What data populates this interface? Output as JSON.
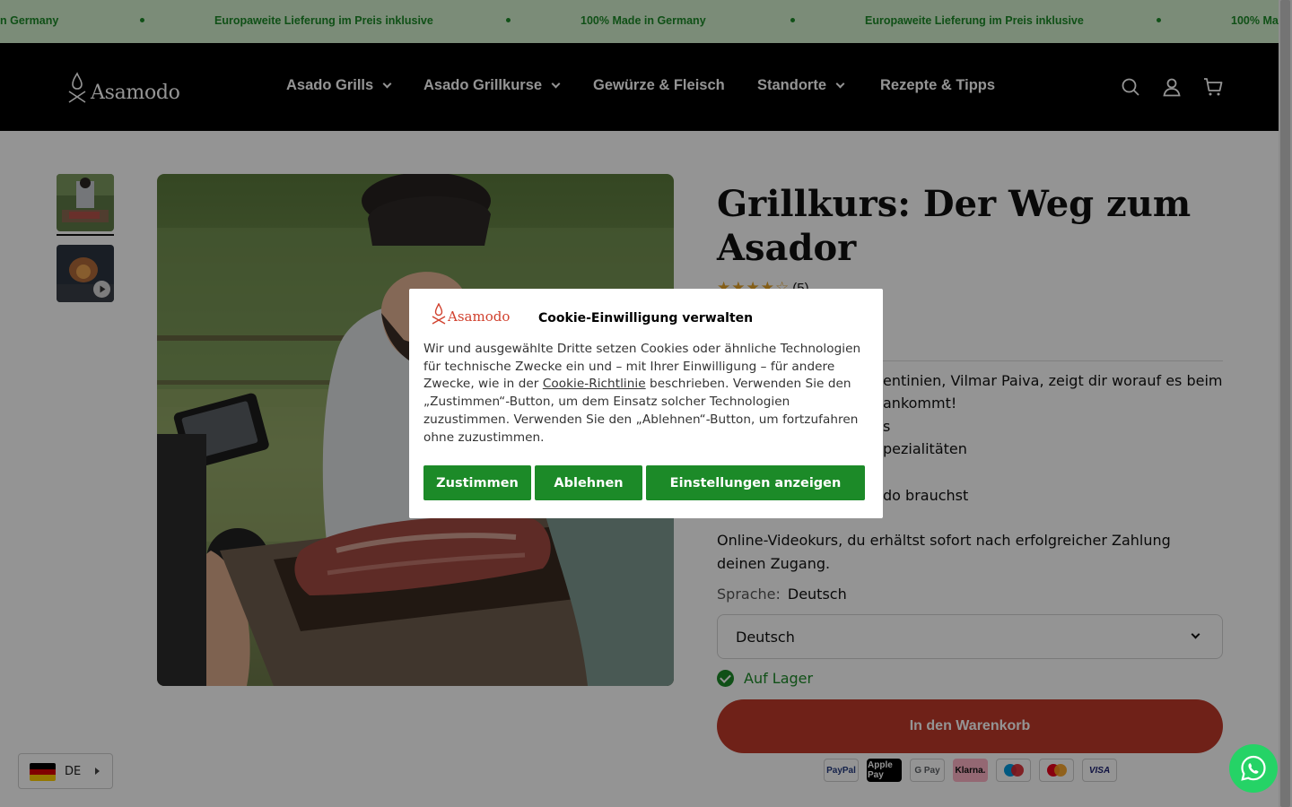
{
  "announcement": {
    "items": [
      "n Germany",
      "Europaweite Lieferung im Preis inklusive",
      "100% Made in Germany",
      "Europaweite Lieferung im Preis inklusive",
      "100% Ma"
    ]
  },
  "header": {
    "logo_text": "Asamodo",
    "nav": [
      {
        "label": "Asado Grills",
        "has_dropdown": true
      },
      {
        "label": "Asado Grillkurse",
        "has_dropdown": true
      },
      {
        "label": "Gewürze & Fleisch",
        "has_dropdown": false
      },
      {
        "label": "Standorte",
        "has_dropdown": true
      },
      {
        "label": "Rezepte & Tipps",
        "has_dropdown": false
      }
    ],
    "icons": [
      "search-icon",
      "account-icon",
      "cart-icon"
    ]
  },
  "gallery": {
    "thumbnails": [
      {
        "type": "image",
        "active": true
      },
      {
        "type": "video",
        "active": false
      }
    ]
  },
  "product": {
    "title": "Grillkurs: Der Weg zum Asador",
    "rating": 4.5,
    "rating_count": "(5)",
    "visible_lines": [
      "entinien, Vilmar Paiva, zeigt dir worauf es beim",
      "ankommt!",
      "s",
      "pezialitäten",
      "do brauchst"
    ],
    "description": "Online-Videokurs, du erhältst sofort nach erfolgreicher Zahlung deinen Zugang.",
    "language_label": "Sprache:",
    "language_value": "Deutsch",
    "language_select": "Deutsch",
    "stock": "Auf Lager",
    "add_to_cart": "In den Warenkorb",
    "payment_methods": [
      "PayPal",
      "Apple Pay",
      "G Pay",
      "Klarna.",
      "Maestro",
      "Mastercard",
      "VISA"
    ]
  },
  "language_switcher": {
    "code": "DE"
  },
  "cookie": {
    "logo_text": "Asamodo",
    "title": "Cookie-Einwilligung verwalten",
    "body_before": "Wir und ausgewählte Dritte setzen Cookies oder ähnliche Technologien für technische Zwecke ein und – mit Ihrer Einwilligung – für andere Zwecke, wie in der ",
    "link": "Cookie-Richtlinie",
    "body_after": " beschrieben. Verwenden Sie den „Zustimmen“-Button, um dem Einsatz solcher Technologien zuzustimmen. Verwenden Sie den „Ablehnen“-Button, um fortzufahren ohne zuzustimmen.",
    "accept": "Zustimmen",
    "decline": "Ablehnen",
    "settings": "Einstellungen anzeigen"
  },
  "colors": {
    "accent_green": "#1c8a28",
    "announce_bg": "#d4f1cf",
    "cart_red": "#bf3a2a",
    "brand_red": "#d1412e",
    "star": "#e3a32a"
  }
}
